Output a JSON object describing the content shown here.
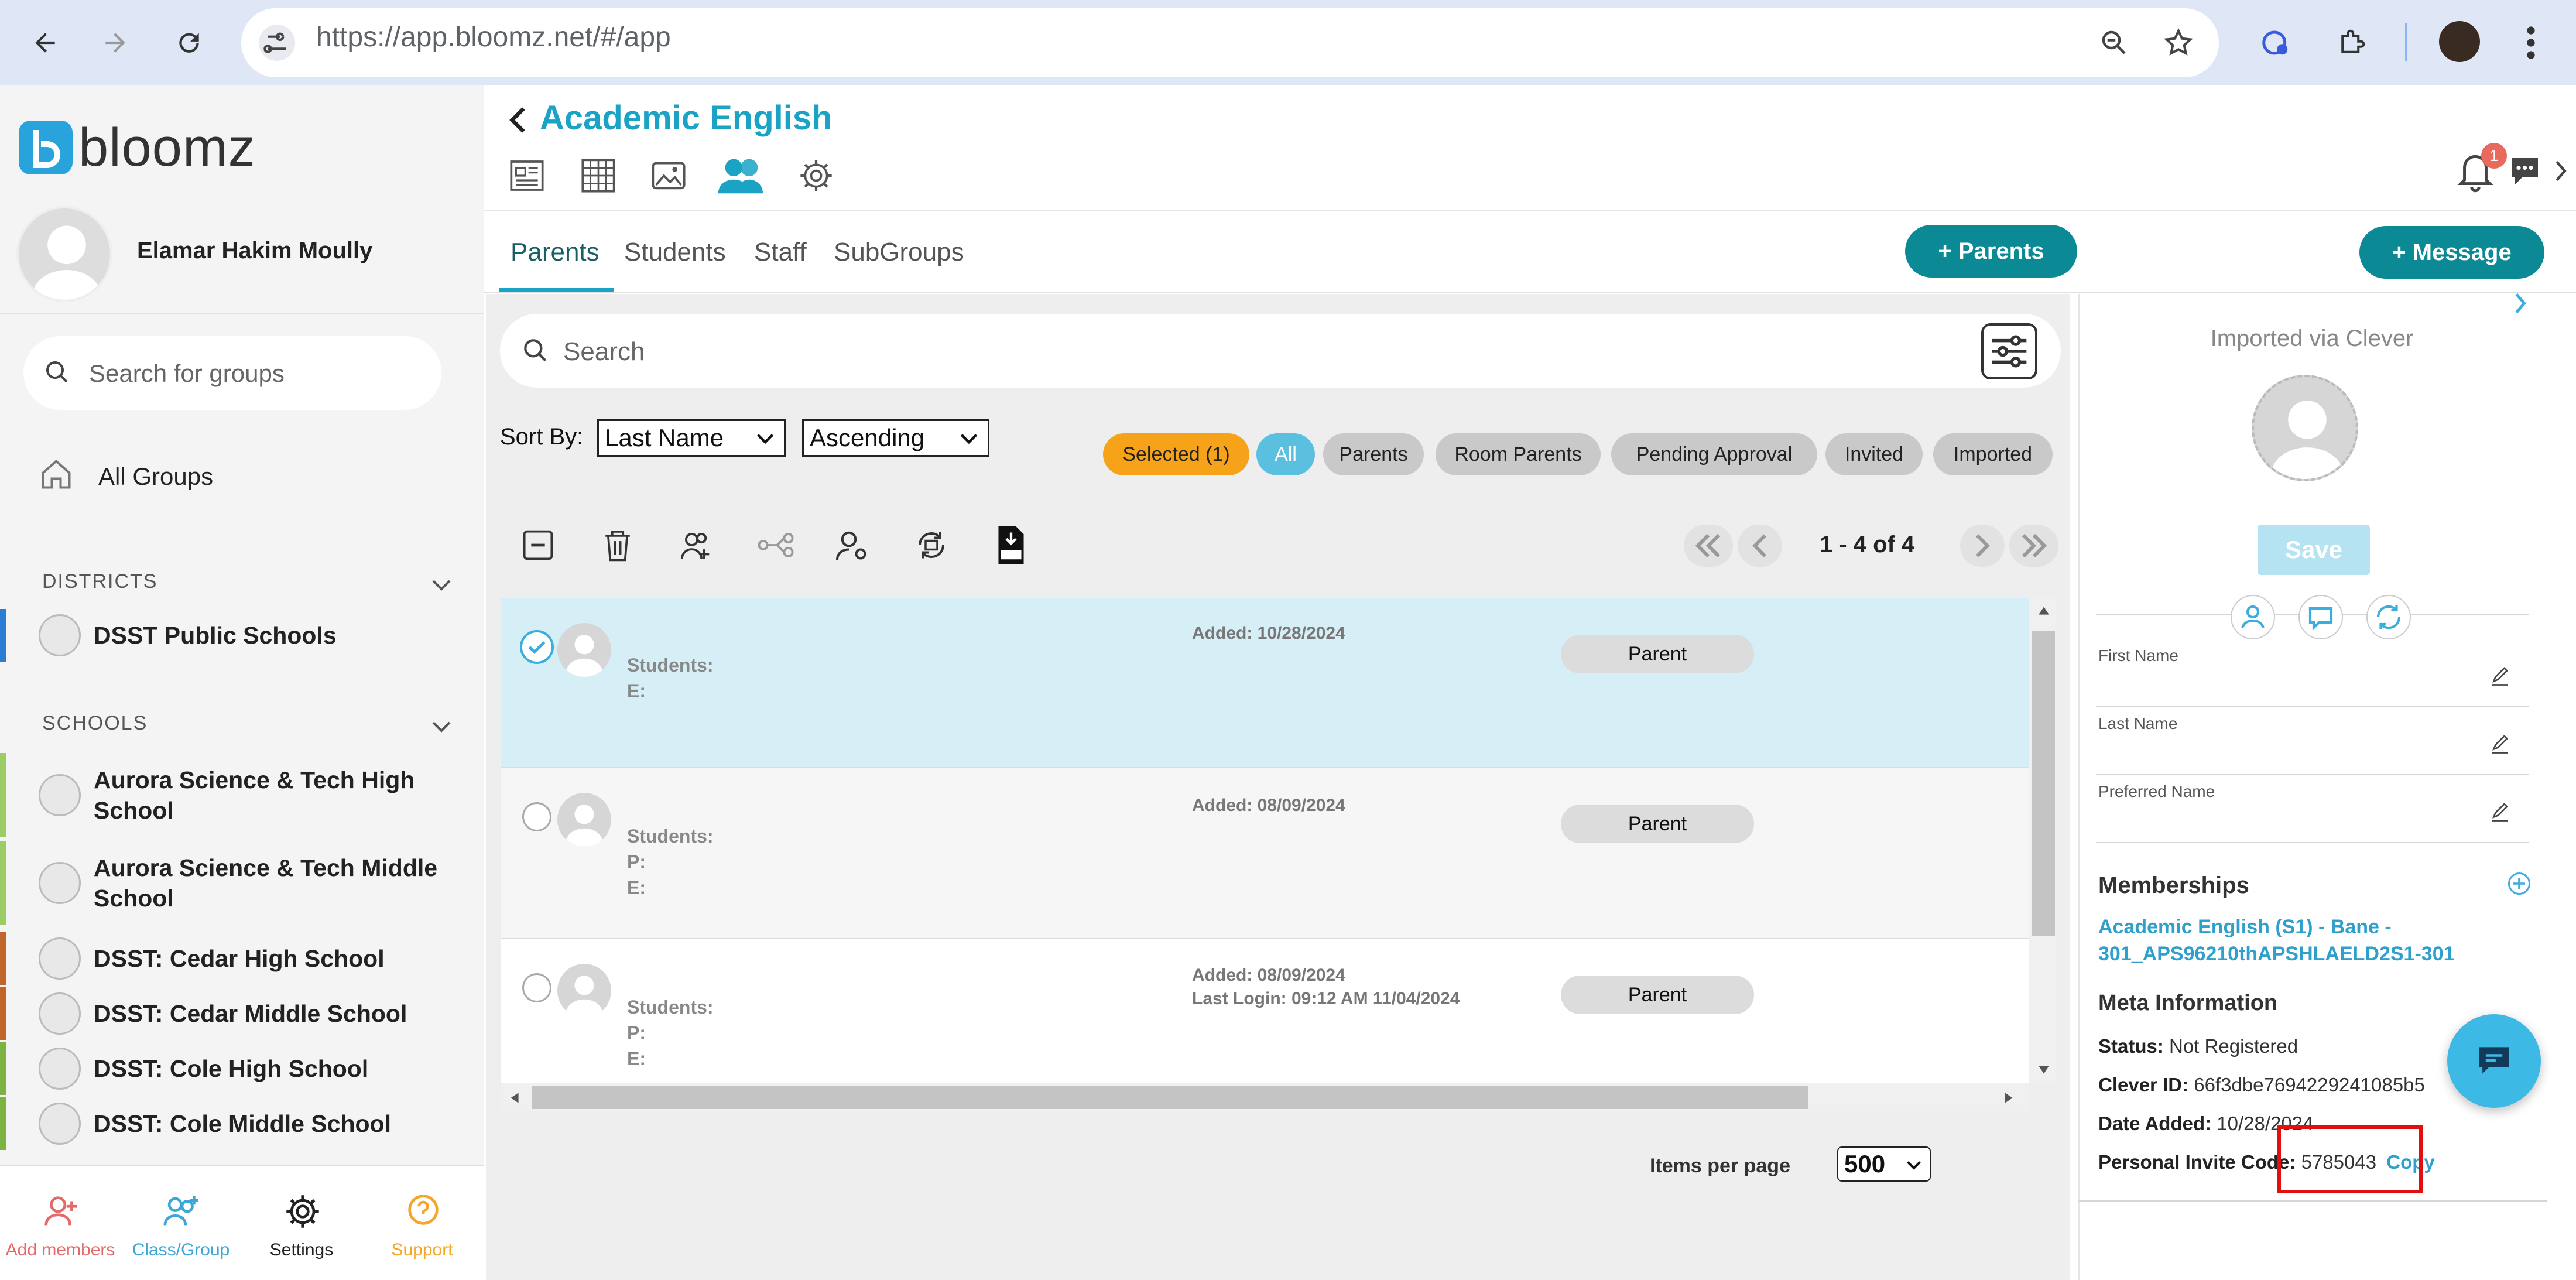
{
  "browser": {
    "url": "https://app.bloomz.net/#/app"
  },
  "sidebar": {
    "brand": "bloomz",
    "user_name": "Elamar Hakim Moully",
    "search_placeholder": "Search for groups",
    "all_groups": "All Groups",
    "districts_label": "DISTRICTS",
    "districts": [
      {
        "name": "DSST Public Schools",
        "color": "#2b7cd3"
      }
    ],
    "schools_label": "SCHOOLS",
    "schools": [
      {
        "name": "Aurora Science & Tech High School",
        "color": "#9ccc65"
      },
      {
        "name": "Aurora Science & Tech Middle School",
        "color": "#9ccc65"
      },
      {
        "name": "DSST: Cedar High School",
        "color": "#c0662b"
      },
      {
        "name": "DSST: Cedar Middle School",
        "color": "#c0662b"
      },
      {
        "name": "DSST: Cole High School",
        "color": "#7cb342"
      },
      {
        "name": "DSST: Cole Middle School",
        "color": "#7cb342"
      }
    ],
    "bottom_nav": [
      {
        "label": "Add members",
        "color": "#e36a6a",
        "icon": "add-member-icon"
      },
      {
        "label": "Class/Group",
        "color": "#3ca7d6",
        "icon": "add-group-icon"
      },
      {
        "label": "Settings",
        "color": "#222222",
        "icon": "gear-icon"
      },
      {
        "label": "Support",
        "color": "#f4a62a",
        "icon": "support-icon"
      }
    ]
  },
  "header": {
    "title": "Academic English",
    "notification_count": "1"
  },
  "tabs": [
    "Parents",
    "Students",
    "Staff",
    "SubGroups"
  ],
  "buttons": {
    "add_parents": "+ Parents",
    "add_message": "+ Message"
  },
  "search": {
    "placeholder": "Search"
  },
  "sort": {
    "label": "Sort By:",
    "field": "Last Name",
    "order": "Ascending"
  },
  "filters": [
    "Selected (1)",
    "All",
    "Parents",
    "Room Parents",
    "Pending Approval",
    "Invited",
    "Imported"
  ],
  "pagination": {
    "range": "1 - 4 of 4"
  },
  "rows": [
    {
      "students": "Students:",
      "phone": "",
      "email": "E:",
      "added": "Added: 10/28/2024",
      "last_login": "",
      "role": "Parent",
      "selected": true
    },
    {
      "students": "Students:",
      "phone": "P:",
      "email": "E:",
      "added": "Added: 08/09/2024",
      "last_login": "",
      "role": "Parent",
      "selected": false
    },
    {
      "students": "Students:",
      "phone": "P:",
      "email": "E:",
      "added": "Added: 08/09/2024",
      "last_login": "Last Login: 09:12 AM 11/04/2024",
      "role": "Parent",
      "selected": false
    }
  ],
  "items_per_page": {
    "label": "Items per page",
    "value": "500"
  },
  "right_panel": {
    "imported_via": "Imported via Clever",
    "save": "Save",
    "fields": [
      {
        "label": "First Name"
      },
      {
        "label": "Last Name"
      },
      {
        "label": "Preferred Name"
      }
    ],
    "memberships_title": "Memberships",
    "membership": "Academic English (S1) - Bane - 301_APS96210thAPSHLAELD2S1-301",
    "meta_title": "Meta Information",
    "status_label": "Status:",
    "status_value": "Not Registered",
    "clever_label": "Clever ID:",
    "clever_value": "66f3dbe7694229241085b5",
    "date_label": "Date Added:",
    "date_value": "10/28/2024",
    "invite_label": "Personal Invite Code:",
    "invite_value": "5785043",
    "copy": "Copy"
  }
}
